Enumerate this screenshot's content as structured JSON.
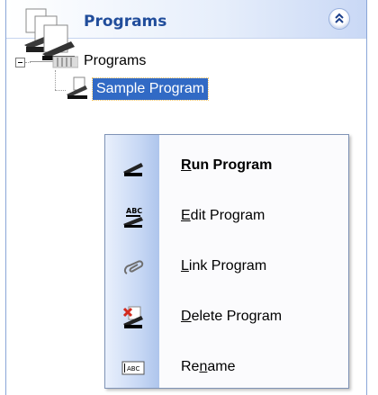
{
  "panel": {
    "title": "Programs",
    "icon": "programs-stack-icon",
    "collapse_icon": "double-chevron-up-icon",
    "accent": "#214d9b"
  },
  "tree": {
    "root": {
      "label": "Programs",
      "icon": "folder-list-icon",
      "expanded": true
    },
    "child": {
      "label": "Sample Program",
      "icon": "scanner-icon",
      "selected": true,
      "selection_color": "#316ac5"
    }
  },
  "context_menu": {
    "items": [
      {
        "pre": "",
        "mn": "R",
        "post": "un Program",
        "icon": "scanner-icon",
        "bold": true
      },
      {
        "pre": "",
        "mn": "E",
        "post": "dit Program",
        "icon": "edit-abc-icon",
        "bold": false
      },
      {
        "pre": "",
        "mn": "L",
        "post": "ink Program",
        "icon": "link-clip-icon",
        "bold": false
      },
      {
        "pre": "",
        "mn": "D",
        "post": "elete Program",
        "icon": "delete-x-icon",
        "bold": false
      },
      {
        "pre": "Re",
        "mn": "n",
        "post": "ame",
        "icon": "rename-abc-icon",
        "bold": false
      }
    ]
  }
}
